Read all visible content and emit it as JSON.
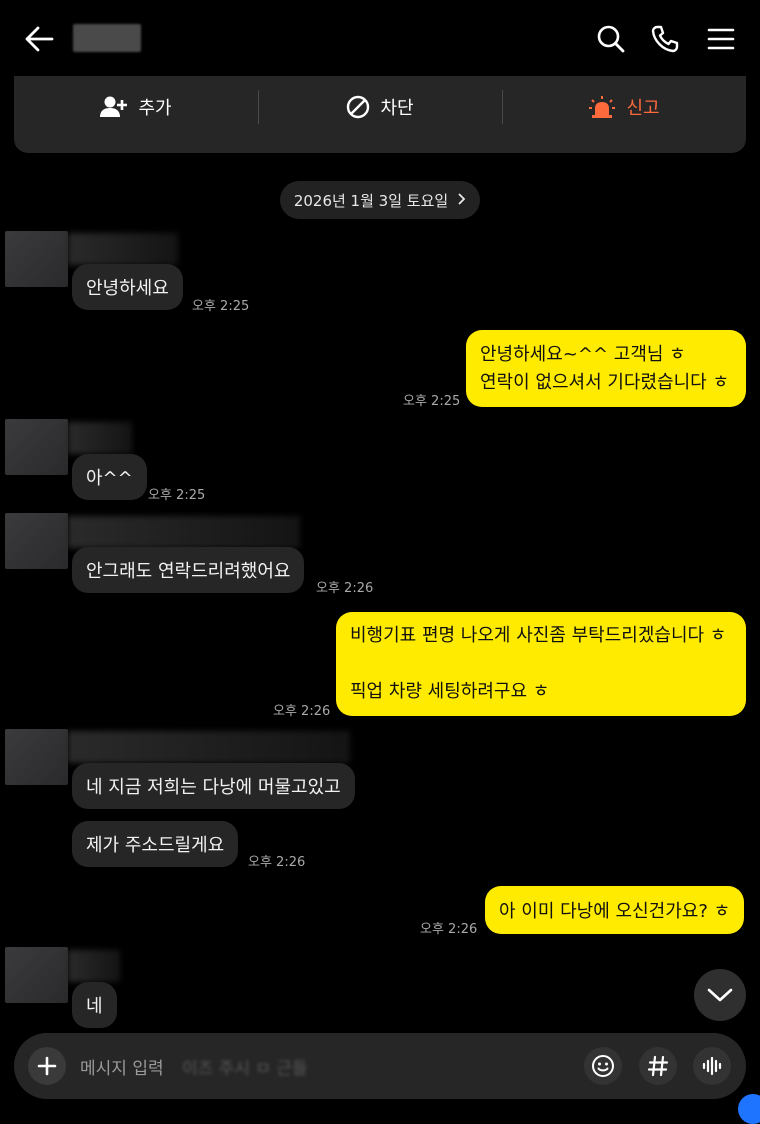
{
  "header": {
    "back_icon": "arrow-left-icon",
    "search_icon": "search-icon",
    "call_icon": "phone-icon",
    "menu_icon": "hamburger-menu-icon"
  },
  "actions": {
    "add_label": "추가",
    "block_label": "차단",
    "report_label": "신고",
    "report_color": "#ff6a3d"
  },
  "date_chip": {
    "label": "2026년 1월 3일 토요일"
  },
  "messages": [
    {
      "sender": "other",
      "text": "안녕하세요",
      "time": "오후 2:25"
    },
    {
      "sender": "me",
      "lines": [
        "안녕하세요~^^  고객님 ㅎ",
        "연락이 없으셔서 기다렸습니다 ㅎ"
      ],
      "time": "오후 2:25"
    },
    {
      "sender": "other",
      "text": "아^^",
      "time": "오후 2:25"
    },
    {
      "sender": "other",
      "text": "안그래도 연락드리려했어요",
      "time": "오후 2:26"
    },
    {
      "sender": "me",
      "lines": [
        "비행기표 편명 나오게 사진좀 부탁드리겠습니다 ㅎ",
        "",
        "픽업 차량 세팅하려구요 ㅎ"
      ],
      "time": "오후 2:26"
    },
    {
      "sender": "other",
      "text": "네 지금 저희는 다낭에 머물고있고",
      "time": ""
    },
    {
      "sender": "other",
      "text": "제가 주소드릴게요",
      "time": "오후 2:26"
    },
    {
      "sender": "me",
      "text": "아 이미 다낭에 오신건가요? ㅎ",
      "time": "오후 2:26"
    },
    {
      "sender": "other",
      "text": "네",
      "time": ""
    }
  ],
  "input": {
    "placeholder": "메시지 입력",
    "ghost_text": "이즈 주시 ㅁ 근들"
  },
  "colors": {
    "my_bubble": "#ffeb00",
    "other_bubble": "#262626",
    "background": "#000000"
  }
}
